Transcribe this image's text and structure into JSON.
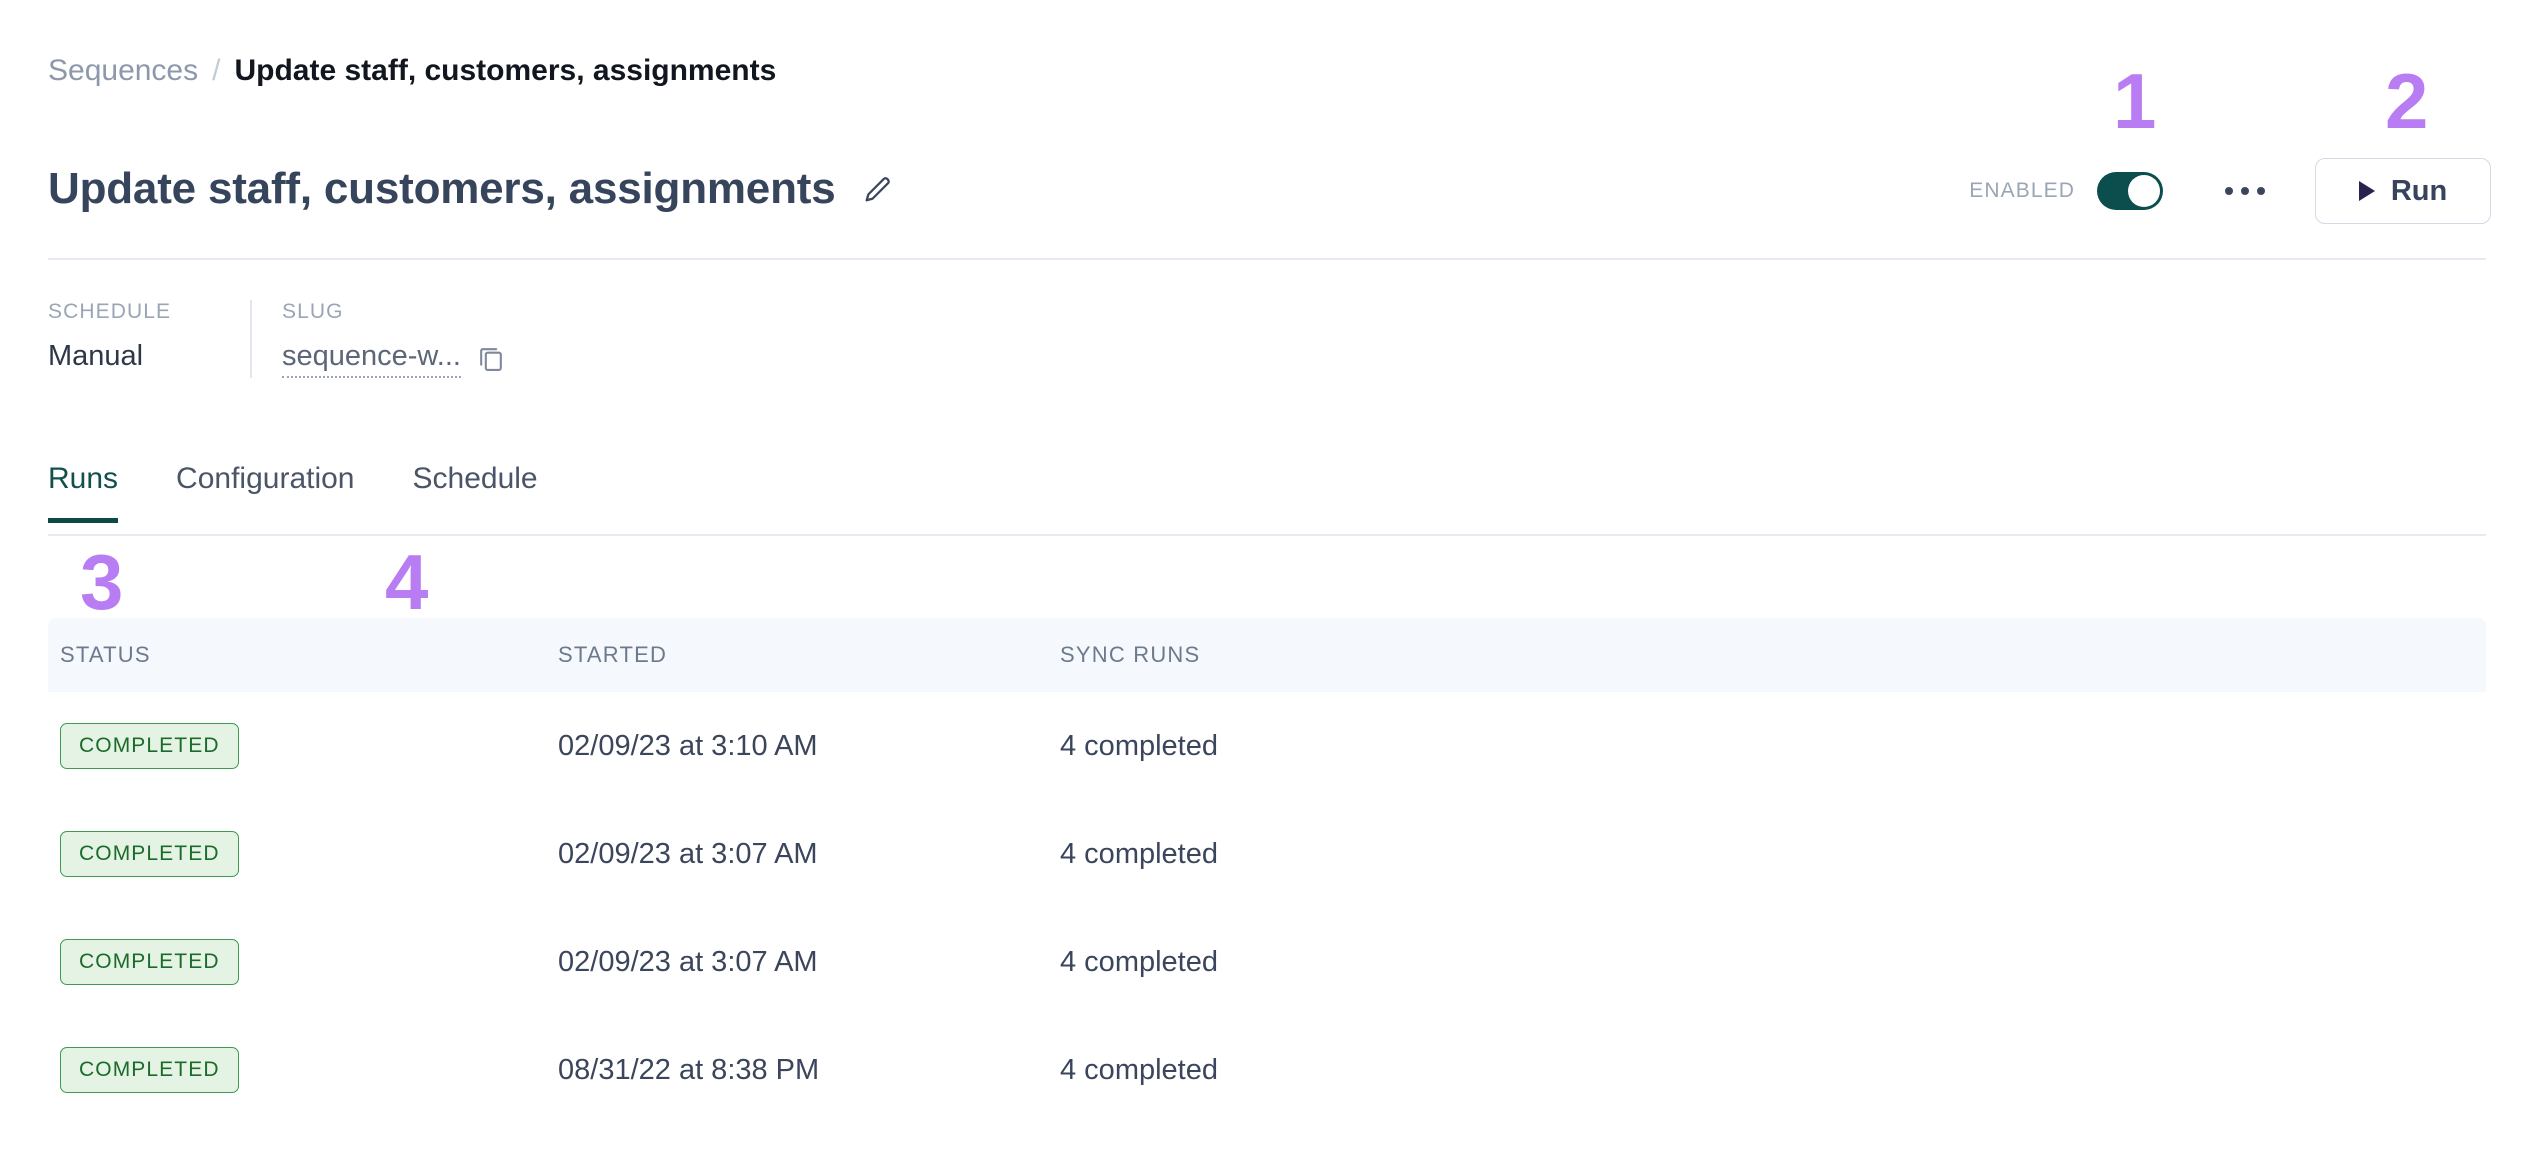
{
  "breadcrumb": {
    "parent": "Sequences",
    "separator": "/",
    "current": "Update staff, customers, assignments"
  },
  "header": {
    "title": "Update staff, customers, assignments",
    "edit_icon": "pencil-icon",
    "enabled_label": "ENABLED",
    "enabled_state": "on",
    "more_icon": "ellipsis-icon",
    "run_label": "Run",
    "run_icon": "play-icon"
  },
  "meta": {
    "schedule": {
      "label": "SCHEDULE",
      "value": "Manual"
    },
    "slug": {
      "label": "SLUG",
      "value": "sequence-w...",
      "copy_icon": "copy-icon"
    }
  },
  "tabs": [
    {
      "label": "Runs",
      "active": true
    },
    {
      "label": "Configuration",
      "active": false
    },
    {
      "label": "Schedule",
      "active": false
    }
  ],
  "table": {
    "columns": [
      "STATUS",
      "STARTED",
      "SYNC RUNS"
    ],
    "rows": [
      {
        "status": "COMPLETED",
        "started": "02/09/23 at 3:10 AM",
        "sync_runs": "4 completed"
      },
      {
        "status": "COMPLETED",
        "started": "02/09/23 at 3:07 AM",
        "sync_runs": "4 completed"
      },
      {
        "status": "COMPLETED",
        "started": "02/09/23 at 3:07 AM",
        "sync_runs": "4 completed"
      },
      {
        "status": "COMPLETED",
        "started": "08/31/22 at 8:38 PM",
        "sync_runs": "4 completed"
      }
    ]
  },
  "annotations": [
    {
      "label": "1",
      "target": "enabled-toggle"
    },
    {
      "label": "2",
      "target": "run-button"
    },
    {
      "label": "3",
      "target": "status-column"
    },
    {
      "label": "4",
      "target": "row-area"
    }
  ],
  "colors": {
    "accent_teal": "#0c4e4e",
    "annotation_purple": "#b87cf3",
    "badge_green_text": "#1d6b2c",
    "badge_green_bg": "#e4f3e4",
    "badge_green_border": "#3d9a4e",
    "header_row_bg": "#f5f8fc",
    "text_primary": "#36445c",
    "text_muted": "#9aa5b5"
  }
}
